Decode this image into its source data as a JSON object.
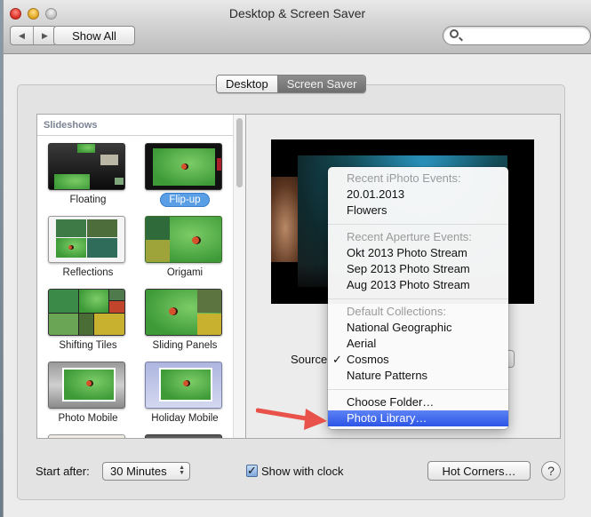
{
  "window": {
    "title": "Desktop & Screen Saver",
    "show_all_label": "Show All",
    "back_icon": "◀",
    "forward_icon": "▶",
    "search_placeholder": ""
  },
  "tabs": [
    {
      "label": "Desktop",
      "selected": false
    },
    {
      "label": "Screen Saver",
      "selected": true
    }
  ],
  "slideshows": {
    "header": "Slideshows",
    "items": [
      {
        "label": "Floating",
        "selected": false
      },
      {
        "label": "Flip-up",
        "selected": true
      },
      {
        "label": "Reflections",
        "selected": false
      },
      {
        "label": "Origami",
        "selected": false
      },
      {
        "label": "Shifting Tiles",
        "selected": false
      },
      {
        "label": "Sliding Panels",
        "selected": false
      },
      {
        "label": "Photo Mobile",
        "selected": false
      },
      {
        "label": "Holiday Mobile",
        "selected": false
      }
    ]
  },
  "source": {
    "label": "Source",
    "selected": "Cosmos",
    "check_glyph": "✓"
  },
  "menu": {
    "sections": [
      {
        "header": "Recent iPhoto Events:",
        "items": [
          "20.01.2013",
          "Flowers"
        ]
      },
      {
        "header": "Recent Aperture Events:",
        "items": [
          "Okt 2013 Photo Stream",
          "Sep 2013 Photo Stream",
          "Aug 2013 Photo Stream"
        ]
      },
      {
        "header": "Default Collections:",
        "items": [
          "National Geographic",
          "Aerial",
          "Cosmos",
          "Nature Patterns"
        ]
      },
      {
        "header": null,
        "items": [
          "Choose Folder…",
          "Photo Library…"
        ]
      }
    ],
    "highlighted": "Photo Library…"
  },
  "bottom": {
    "start_after_label": "Start after:",
    "start_after_value": "30 Minutes",
    "show_clock_label": "Show with clock",
    "show_clock_checked": true,
    "hot_corners_label": "Hot Corners…",
    "help_label": "?"
  },
  "annotation": {
    "arrow_color": "#e8524a"
  },
  "colors": {
    "highlight": "#2c55e6",
    "selected_badge": "#5a9ee6"
  }
}
